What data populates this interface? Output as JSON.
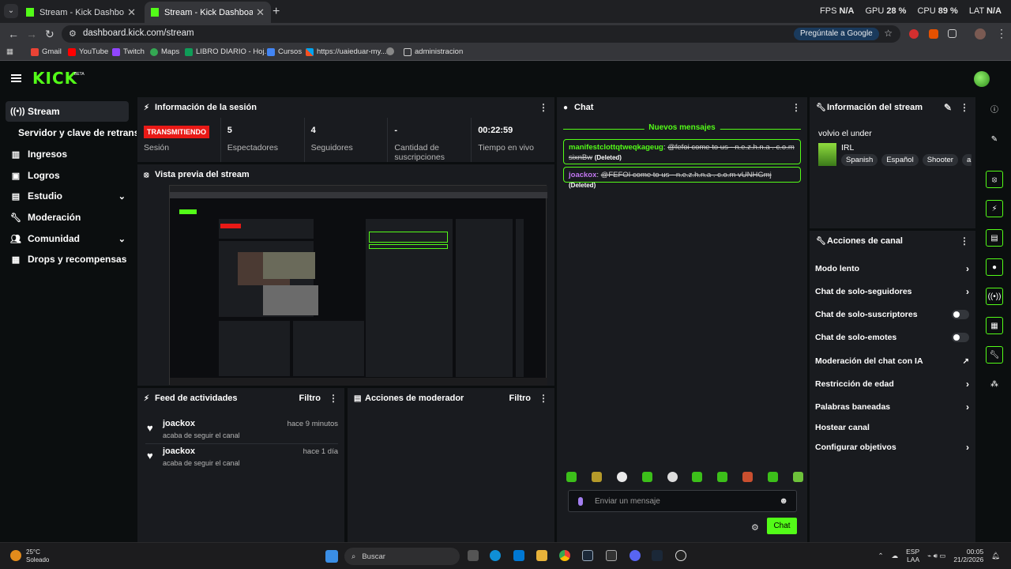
{
  "browser": {
    "tabs": [
      {
        "title": "Stream - Kick Dashboard",
        "active": false
      },
      {
        "title": "Stream - Kick Dashboard",
        "active": true
      }
    ],
    "perf": {
      "fps_label": "FPS",
      "fps": "N/A",
      "gpu_label": "GPU",
      "gpu": "28 %",
      "cpu_label": "CPU",
      "cpu": "89 %",
      "lat_label": "LAT",
      "lat": "N/A"
    },
    "url": "dashboard.kick.com/stream",
    "ask_google": "Pregúntale a Google",
    "bookmarks": [
      "Gmail",
      "YouTube",
      "Twitch",
      "Maps",
      "LIBRO DIARIO - Hoj...",
      "Cursos",
      "https://uaieduar-my...",
      "administracion"
    ]
  },
  "header": {
    "logo": "KICK",
    "beta": "BETA"
  },
  "sidebar": {
    "items": [
      {
        "label": "Stream",
        "icon": "stream-icon",
        "active": true
      },
      {
        "label": "Servidor y clave de retransmisión",
        "icon": ""
      },
      {
        "label": "Ingresos",
        "icon": "money-icon"
      },
      {
        "label": "Logros",
        "icon": "trophy-icon"
      },
      {
        "label": "Estudio",
        "icon": "studio-icon",
        "chevron": true
      },
      {
        "label": "Moderación",
        "icon": "wrench-icon"
      },
      {
        "label": "Comunidad",
        "icon": "community-icon",
        "chevron": true
      },
      {
        "label": "Drops y recompensas",
        "icon": "drops-icon"
      }
    ]
  },
  "session": {
    "title": "Información de la sesión",
    "live_badge": "TRANSMITIENDO",
    "stats": [
      {
        "value": "",
        "label": "Sesión"
      },
      {
        "value": "5",
        "label": "Espectadores"
      },
      {
        "value": "4",
        "label": "Seguidores"
      },
      {
        "value": "-",
        "label": "Cantidad de suscripciones"
      },
      {
        "value": "00:22:59",
        "label": "Tiempo en vivo"
      }
    ]
  },
  "preview": {
    "title": "Vista previa del stream"
  },
  "feed": {
    "title": "Feed de actividades",
    "filter": "Filtro",
    "items": [
      {
        "user": "joackox",
        "time": "hace 9 minutos",
        "desc": "acaba de seguir el canal"
      },
      {
        "user": "joackox",
        "time": "hace 1 día",
        "desc": "acaba de seguir el canal"
      }
    ]
  },
  "modactions": {
    "title": "Acciones de moderador",
    "filter": "Filtro"
  },
  "chat": {
    "title": "Chat",
    "new_messages": "Nuevos mensajes",
    "messages": [
      {
        "user": "manifestclottqtweqkageug",
        "text": "@fefoi come to us - n.e.z.h.n.a . c.o.m sixnBw",
        "deleted": "(Deleted)",
        "color": "#53fc18"
      },
      {
        "user": "joackox",
        "text": "@FEFOI come to us - n.e.z.h.n.a . c.o.m vUNHGmj",
        "deleted": "(Deleted)",
        "color": "#c377f2"
      }
    ],
    "placeholder": "Enviar un mensaje",
    "send": "Chat"
  },
  "streaminfo": {
    "title": "Información del stream",
    "stream_title": "volvio el under",
    "category": "IRL",
    "tags": [
      "Spanish",
      "Español",
      "Shooter",
      "a"
    ]
  },
  "actions": {
    "title": "Acciones de canal",
    "items": [
      {
        "label": "Modo lento",
        "control": "chevron"
      },
      {
        "label": "Chat de solo-seguidores",
        "control": "chevron"
      },
      {
        "label": "Chat de solo-suscriptores",
        "control": "toggle"
      },
      {
        "label": "Chat de solo-emotes",
        "control": "toggle"
      },
      {
        "label": "Moderación del chat con IA",
        "control": "external"
      },
      {
        "label": "Restricción de edad",
        "control": "chevron"
      },
      {
        "label": "Palabras baneadas",
        "control": "chevron"
      },
      {
        "label": "Hostear canal",
        "control": "none"
      },
      {
        "label": "Configurar objetivos",
        "control": "chevron"
      }
    ]
  },
  "taskbar": {
    "temp": "25°C",
    "weather": "Soleado",
    "search": "Buscar",
    "lang1": "ESP",
    "lang2": "LAA",
    "time": "00:05",
    "date": "21/2/2026"
  },
  "colors": {
    "accent": "#53fc18",
    "live": "#e91916",
    "panel": "#191b1f",
    "bg": "#0b0e0f"
  }
}
